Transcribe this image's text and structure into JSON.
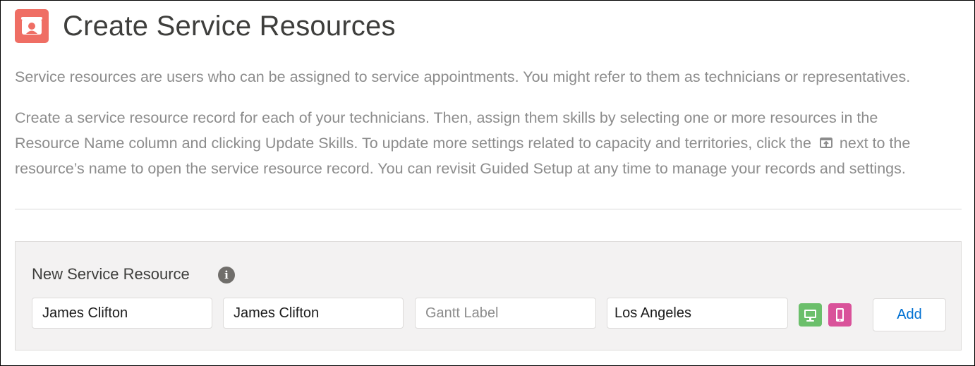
{
  "header": {
    "title": "Create Service Resources",
    "icon": "service-resource-icon",
    "icon_color": "#ef6e64"
  },
  "intro": {
    "paragraph1": "Service resources are users who can be assigned to service appointments. You might refer to them as technicians or representatives.",
    "paragraph2_line1": "Create a service resource record for each of your technicians. Then, assign them skills by selecting one or more resources in the",
    "paragraph2_line2_before_icon": "Resource Name column and clicking Update Skills. To update more settings related to capacity and territories, click the",
    "paragraph2_inline_icon": "open-record-icon",
    "paragraph2_line2_after_icon": "next to the",
    "paragraph2_line3": "resource’s name to open the service resource record. You can revisit Guided Setup at any time to manage your records and settings."
  },
  "new_resource": {
    "title": "New Service Resource",
    "info_icon": "info-icon",
    "fields": {
      "user_value": "James Clifton",
      "name_value": "James Clifton",
      "gantt_label_placeholder": "Gantt Label",
      "gantt_label_value": "",
      "territory_value": "Los Angeles"
    },
    "channels": {
      "desktop_icon": "desktop-icon",
      "desktop_color": "#6bbf6b",
      "mobile_icon": "mobile-icon",
      "mobile_color": "#d9529a"
    },
    "add_label": "Add"
  }
}
